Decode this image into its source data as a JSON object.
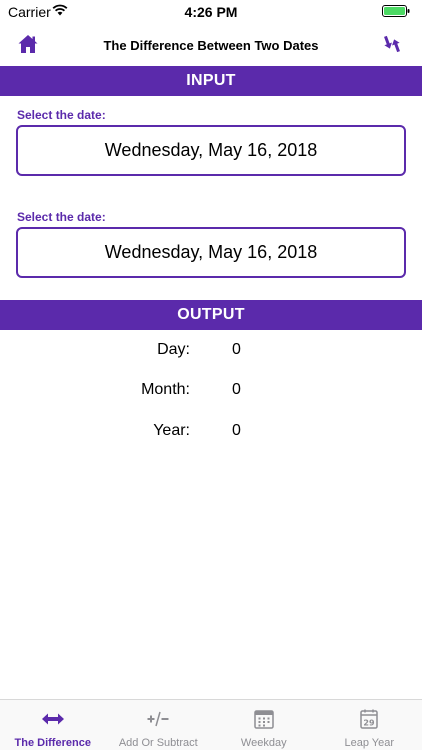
{
  "status_bar": {
    "carrier": "Carrier",
    "time": "4:26 PM"
  },
  "nav": {
    "title": "The Difference Between Two Dates",
    "left_icon": "home-icon",
    "right_icon": "swap-icon"
  },
  "input": {
    "header": "INPUT",
    "date1": {
      "label": "Select the date:",
      "value": "Wednesday, May 16, 2018"
    },
    "date2": {
      "label": "Select the date:",
      "value": "Wednesday, May 16, 2018"
    }
  },
  "output": {
    "header": "OUTPUT",
    "day": {
      "label": "Day:",
      "value": "0"
    },
    "month": {
      "label": "Month:",
      "value": "0"
    },
    "year": {
      "label": "Year:",
      "value": "0"
    }
  },
  "tabs": [
    {
      "label": "The Difference",
      "icon": "arrows-horizontal-icon",
      "active": true
    },
    {
      "label": "Add Or Subtract",
      "icon": "plus-minus-icon",
      "active": false
    },
    {
      "label": "Weekday",
      "icon": "calendar-icon",
      "active": false
    },
    {
      "label": "Leap Year",
      "icon": "calendar-29-icon",
      "active": false
    }
  ],
  "colors": {
    "accent": "#5b2aab",
    "inactive": "#8e8e93"
  }
}
